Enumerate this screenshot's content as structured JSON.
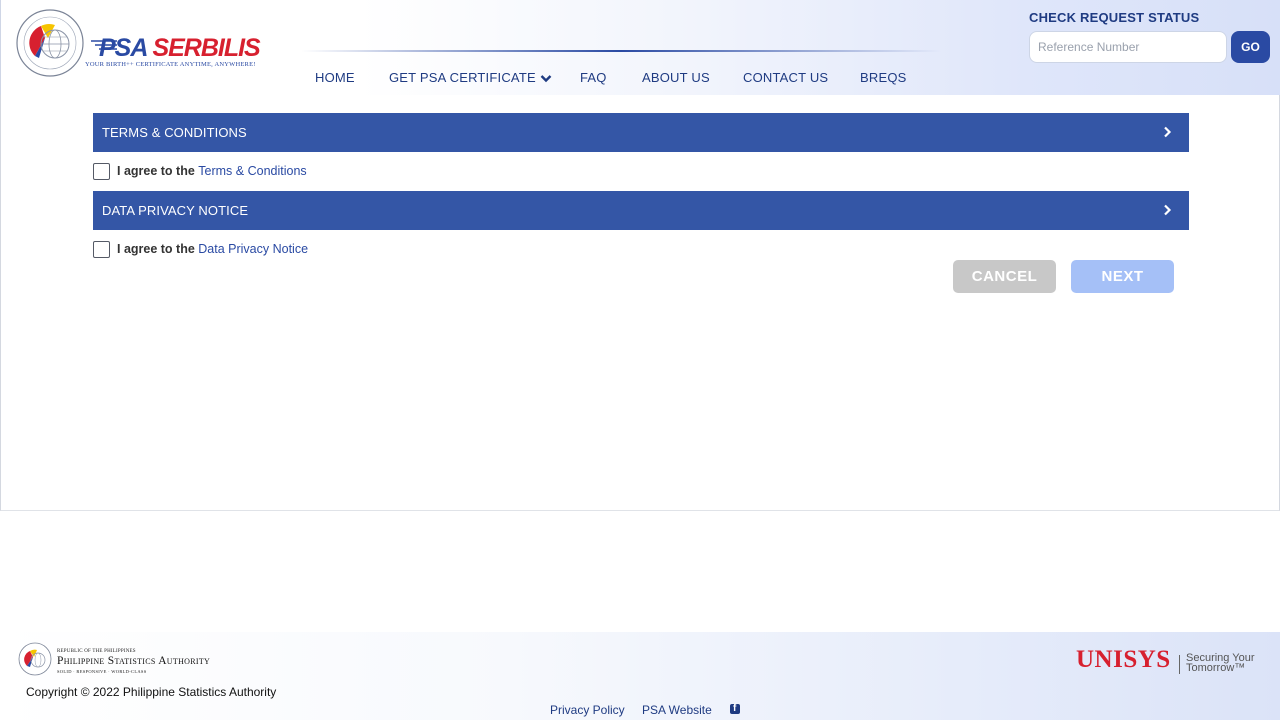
{
  "header": {
    "logo": {
      "brand_psa": "PSA",
      "brand_serbilis": "SERBILIS",
      "tagline": "YOUR BIRTH++ CERTIFICATE ANYTIME, ANYWHERE!",
      "seal_text": "PHILIPPINE STATISTICS AUTHORITY"
    },
    "nav": [
      {
        "label": "HOME"
      },
      {
        "label": "GET PSA CERTIFICATE",
        "icon": "chevron-down-icon"
      },
      {
        "label": "FAQ"
      },
      {
        "label": "ABOUT US"
      },
      {
        "label": "CONTACT US"
      },
      {
        "label": "BREQS"
      }
    ],
    "check_status": {
      "title": "CHECK REQUEST STATUS",
      "placeholder": "Reference Number",
      "value": "",
      "go_label": "GO"
    }
  },
  "main": {
    "terms_panel": {
      "title": "TERMS & CONDITIONS",
      "icon": "chevron-right-icon"
    },
    "terms_agree": {
      "prefix": "I agree to the",
      "link": "Terms & Conditions",
      "checked": false
    },
    "privacy_panel": {
      "title": "DATA PRIVACY NOTICE",
      "icon": "chevron-right-icon"
    },
    "privacy_agree": {
      "prefix": "I agree to the",
      "link": "Data Privacy Notice",
      "checked": false
    },
    "cancel_label": "CANCEL",
    "next_label": "NEXT"
  },
  "footer": {
    "org_small": "REPUBLIC OF THE PHILIPPINES",
    "org_name": "Philippine Statistics Authority",
    "org_tag": "SOLID · RESPONSIVE · WORLD-CLASS",
    "copyright": "Copyright © 2022 Philippine Statistics Authority",
    "links": [
      {
        "label": "Privacy Policy"
      },
      {
        "label": "PSA Website"
      }
    ],
    "social_icon": "facebook-icon",
    "partner": {
      "name": "UNISYS",
      "tagline_line1": "Securing Your",
      "tagline_line2": "Tomorrow™"
    }
  },
  "colors": {
    "primary_blue": "#3456a6",
    "nav_blue": "#1f3b82",
    "brand_red": "#d7202f",
    "cancel_gray": "#c8c8c8",
    "next_disabled_blue": "#a5c0f7"
  }
}
